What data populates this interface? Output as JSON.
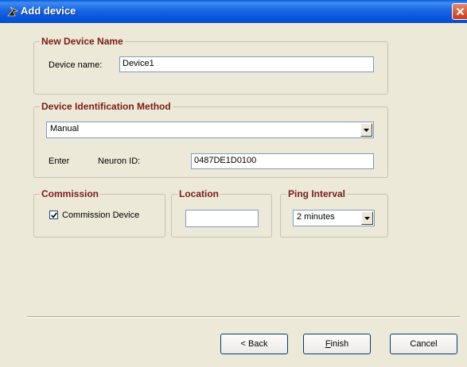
{
  "window": {
    "title": "Add device",
    "icon": "arrow-pointer-icon",
    "close": "close-icon"
  },
  "new_device_name": {
    "legend": "New Device Name",
    "label": "Device name:",
    "value": "Device1"
  },
  "identification": {
    "legend": "Device Identification Method",
    "method_value": "Manual",
    "enter_label": "Enter",
    "neuron_label": "Neuron ID:",
    "neuron_value": "0487DE1D0100"
  },
  "commission": {
    "legend": "Commission",
    "checkbox_label": "Commission Device",
    "checked": true
  },
  "location": {
    "legend": "Location",
    "value": ""
  },
  "ping": {
    "legend": "Ping Interval",
    "value": "2 minutes"
  },
  "buttons": {
    "back": "< Back",
    "finish_accel": "F",
    "finish_rest": "inish",
    "cancel": "Cancel"
  },
  "colors": {
    "legend_text": "#7a1c18",
    "titlebar": "#0855dd",
    "dialog_bg": "#ece9d8"
  }
}
